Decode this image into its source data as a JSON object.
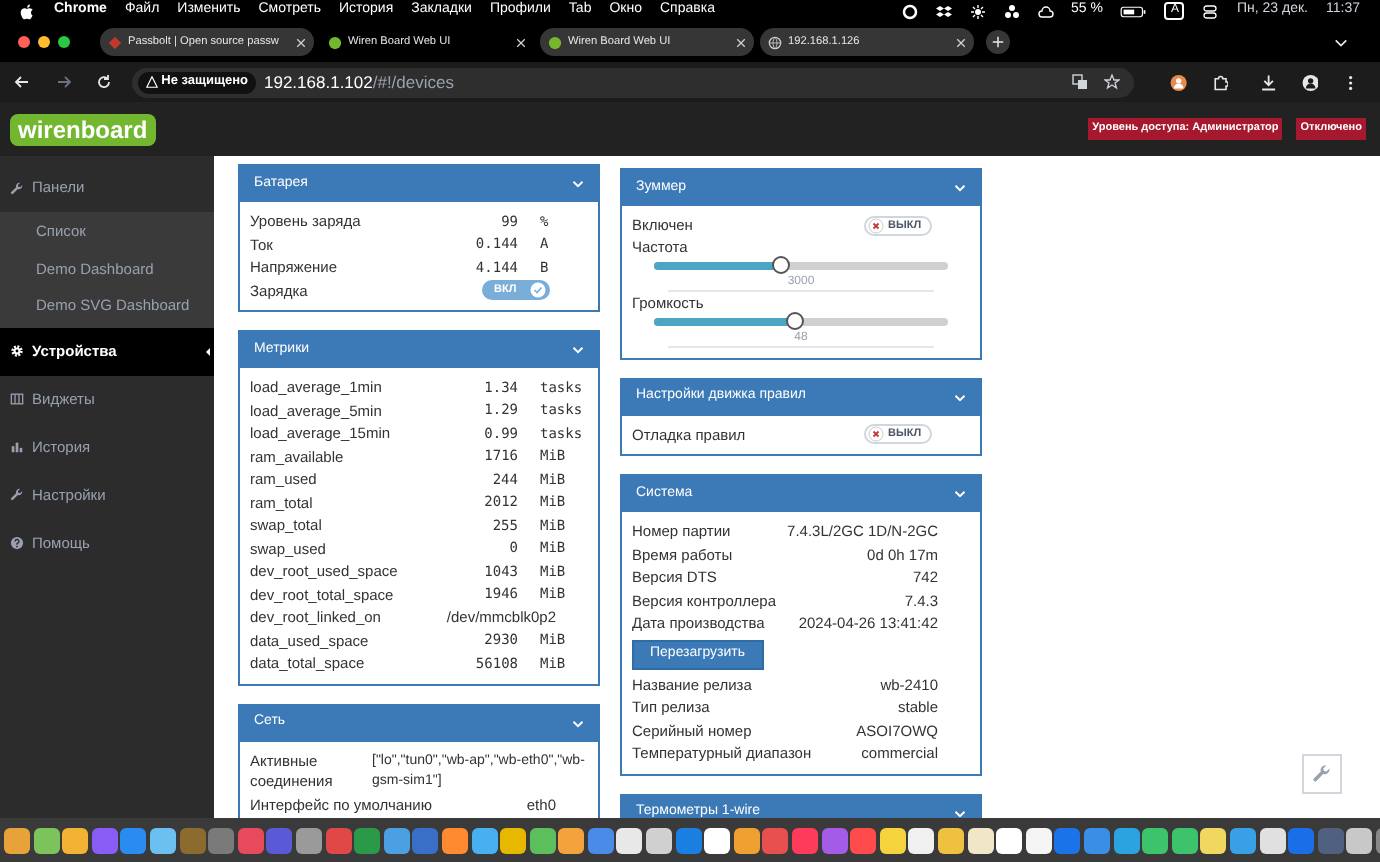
{
  "menu_bar": {
    "app": "Chrome",
    "items": [
      "Файл",
      "Изменить",
      "Смотреть",
      "История",
      "Закладки",
      "Профили",
      "Tab",
      "Окно",
      "Справка"
    ],
    "battery": "55 %",
    "input_source": "A",
    "date": "Пн, 23 дек.",
    "time": "11:37"
  },
  "browser": {
    "tabs": [
      {
        "title": "Passbolt | Open source passw",
        "selected": false
      },
      {
        "title": "Wiren Board Web UI",
        "selected": true
      },
      {
        "title": "Wiren Board Web UI",
        "selected": false
      },
      {
        "title": "192.168.1.126",
        "selected": false
      }
    ],
    "security_chip": "Не защищено",
    "url_host": "192.168.1.102",
    "url_path": "/#!/devices"
  },
  "header": {
    "logo": "wirenboard",
    "badges": [
      "Уровень доступа: Администратор",
      "Отключено"
    ]
  },
  "sidebar": {
    "items": [
      {
        "label": "Панели",
        "selected": false,
        "expanded": true,
        "children": [
          {
            "label": "Список",
            "selected": false
          },
          {
            "label": "Demo Dashboard",
            "selected": false
          },
          {
            "label": "Demo SVG Dashboard",
            "selected": false
          }
        ]
      },
      {
        "label": "Устройства",
        "selected": true
      },
      {
        "label": "Виджеты",
        "selected": false
      },
      {
        "label": "История",
        "selected": false
      },
      {
        "label": "Настройки",
        "selected": false
      },
      {
        "label": "Помощь",
        "selected": false
      }
    ]
  },
  "columns": [
    [
      {
        "title": "Батарея",
        "rows": [
          {
            "kind": "value",
            "label": "Уровень заряда",
            "value": "99",
            "unit": "%"
          },
          {
            "kind": "value",
            "label": "Ток",
            "value": "0.144",
            "unit": "A"
          },
          {
            "kind": "value",
            "label": "Напряжение",
            "value": "4.144",
            "unit": "B"
          },
          {
            "kind": "switch",
            "label": "Зарядка",
            "on": true,
            "text": "ВКЛ"
          }
        ]
      },
      {
        "title": "Метрики",
        "rows": [
          {
            "kind": "value",
            "label": "load_average_1min",
            "value": "1.34",
            "unit": "tasks"
          },
          {
            "kind": "value",
            "label": "load_average_5min",
            "value": "1.29",
            "unit": "tasks"
          },
          {
            "kind": "value",
            "label": "load_average_15min",
            "value": "0.99",
            "unit": "tasks"
          },
          {
            "kind": "value",
            "label": "ram_available",
            "value": "1716",
            "unit": "MiB"
          },
          {
            "kind": "value",
            "label": "ram_used",
            "value": "244",
            "unit": "MiB"
          },
          {
            "kind": "value",
            "label": "ram_total",
            "value": "2012",
            "unit": "MiB"
          },
          {
            "kind": "value",
            "label": "swap_total",
            "value": "255",
            "unit": "MiB"
          },
          {
            "kind": "value",
            "label": "swap_used",
            "value": "0",
            "unit": "MiB"
          },
          {
            "kind": "value",
            "label": "dev_root_used_space",
            "value": "1043",
            "unit": "MiB"
          },
          {
            "kind": "value",
            "label": "dev_root_total_space",
            "value": "1946",
            "unit": "MiB"
          },
          {
            "kind": "text",
            "label": "dev_root_linked_on",
            "value": "/dev/mmcblk0p2"
          },
          {
            "kind": "value",
            "label": "data_used_space",
            "value": "2930",
            "unit": "MiB"
          },
          {
            "kind": "value",
            "label": "data_total_space",
            "value": "56108",
            "unit": "MiB"
          }
        ]
      },
      {
        "title": "Сеть",
        "rows": [
          {
            "kind": "list",
            "label": "Активные соединения",
            "value": "[\"lo\",\"tun0\",\"wb-ap\",\"wb-eth0\",\"wb-gsm-sim1\"]"
          },
          {
            "kind": "text",
            "label": "Интерфейс по умолчанию",
            "value": "eth0"
          }
        ]
      }
    ],
    [
      {
        "title": "Зуммер",
        "rows": [
          {
            "kind": "switch",
            "label": "Включен",
            "on": false,
            "text": "ВЫКЛ"
          },
          {
            "kind": "slider",
            "label": "Частота",
            "level": 0.43,
            "value": "3000"
          },
          {
            "kind": "slider",
            "label": "Громкость",
            "level": 0.48,
            "value": "48"
          }
        ]
      },
      {
        "title": "Настройки движка правил",
        "rows": [
          {
            "kind": "switch",
            "label": "Отладка правил",
            "on": false,
            "text": "ВЫКЛ"
          }
        ]
      },
      {
        "title": "Система",
        "rows": [
          {
            "kind": "text",
            "label": "Номер партии",
            "value": "7.4.3L/2GC 1D/N-2GC"
          },
          {
            "kind": "text",
            "label": "Время работы",
            "value": "0d 0h 17m"
          },
          {
            "kind": "text",
            "label": "Версия DTS",
            "value": "742"
          },
          {
            "kind": "text",
            "label": "Версия контроллера",
            "value": "7.4.3"
          },
          {
            "kind": "text",
            "label": "Дата производства",
            "value": "2024-04-26 13:41:42"
          },
          {
            "kind": "button",
            "label": "Перезагрузить"
          },
          {
            "kind": "text",
            "label": "Название релиза",
            "value": "wb-2410"
          },
          {
            "kind": "text",
            "label": "Тип релиза",
            "value": "stable"
          },
          {
            "kind": "text",
            "label": "Серийный номер",
            "value": "ASOI7OWQ"
          },
          {
            "kind": "text",
            "label": "Температурный диапазон",
            "value": "commercial"
          }
        ]
      },
      {
        "title": "Термометры 1-wire"
      }
    ]
  ]
}
